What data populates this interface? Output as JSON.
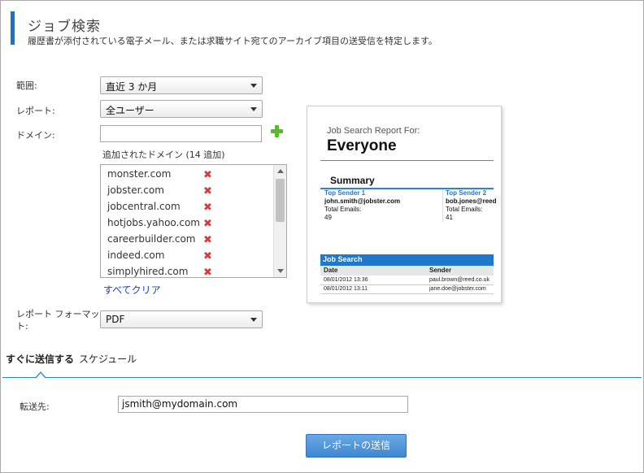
{
  "header": {
    "title": "ジョブ検索",
    "subtitle": "履歴書が添付されている電子メール、または求職サイト宛てのアーカイブ項目の送受信を特定します。"
  },
  "form": {
    "range_label": "範囲:",
    "range_value": "直近 3 か月",
    "report_label": "レポート:",
    "report_value": "全ユーザー",
    "domain_label": "ドメイン:",
    "domain_input_value": "",
    "added_domains_label": "追加されたドメイン (14 追加)",
    "domains": [
      "monster.com",
      "jobster.com",
      "jobcentral.com",
      "hotjobs.yahoo.com",
      "careerbuilder.com",
      "indeed.com",
      "simplyhired.com"
    ],
    "clear_all_label": "すべてクリア",
    "format_label_line1": "レポート フォーマッ",
    "format_label_line2": "ト:",
    "format_value": "PDF"
  },
  "preview": {
    "heading": "Job Search Report For:",
    "audience": "Everyone",
    "summary_title": "Summary",
    "senders": [
      {
        "title": "Top Sender 1",
        "email": "john.smith@jobster.com",
        "label": "Total Emails:",
        "count": "49"
      },
      {
        "title": "Top Sender 2",
        "email": "bob.jones@reed.",
        "label": "Total Emails:",
        "count": "41"
      }
    ],
    "job_search_title": "Job Search",
    "columns": [
      "Date",
      "Sender"
    ],
    "rows": [
      {
        "date": "08/01/2012 13:36",
        "sender": "paul.brown@reed.co.uk"
      },
      {
        "date": "08/01/2012 13:11",
        "sender": "jane.doe@jobster.com"
      }
    ]
  },
  "tabs": {
    "send_now": "すぐに送信する",
    "schedule": "スケジュール"
  },
  "send": {
    "to_label": "転送先:",
    "to_value": "jsmith@mydomain.com",
    "submit_label": "レポートの送信"
  },
  "colors": {
    "accent": "#1a73c9",
    "remove": "#d63a3a",
    "add": "#5cb82d",
    "link": "#1a3fc0"
  }
}
